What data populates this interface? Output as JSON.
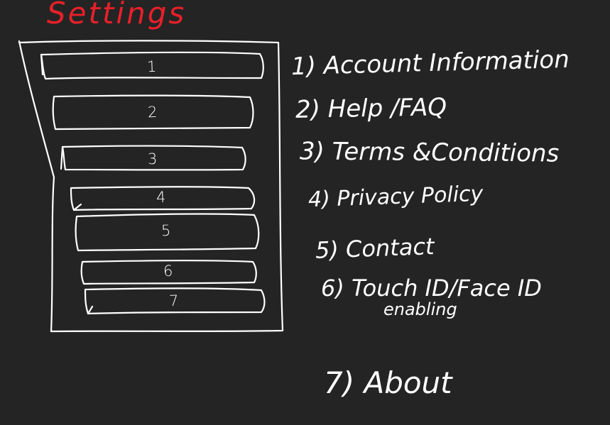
{
  "title": "Settings",
  "colors": {
    "background": "#242424",
    "title": "#e8202a",
    "ink": "#ffffff"
  },
  "menu_slots": [
    {
      "number": "1"
    },
    {
      "number": "2"
    },
    {
      "number": "3"
    },
    {
      "number": "4"
    },
    {
      "number": "5"
    },
    {
      "number": "6"
    },
    {
      "number": "7"
    }
  ],
  "legend": [
    {
      "text": "1) Account Information"
    },
    {
      "text": "2) Help /FAQ"
    },
    {
      "text": "3) Terms &Conditions"
    },
    {
      "text": "4) Privacy Policy"
    },
    {
      "text": "5) Contact"
    },
    {
      "text": "6) Touch ID/Face ID",
      "continuation": "enabling"
    },
    {
      "text": "7) About"
    }
  ]
}
